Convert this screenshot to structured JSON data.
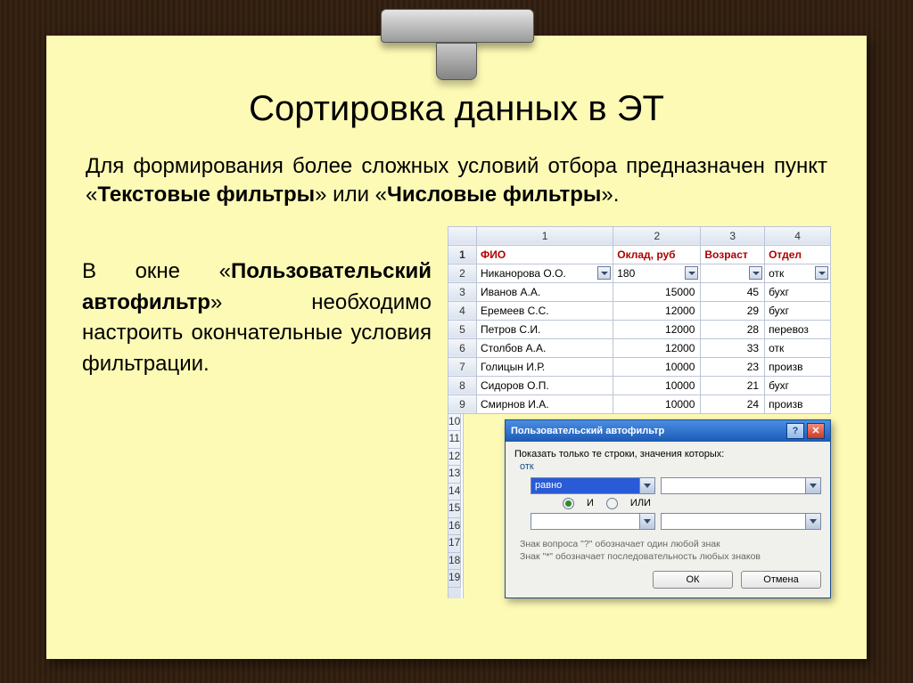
{
  "title": "Сортировка данных в ЭТ",
  "para1_parts": {
    "p1": "Для формирования более сложных условий отбора предназначен пункт «",
    "b1": "Текстовые фильтры",
    "p2": "» или «",
    "b2": "Числовые фильтры",
    "p3": "»."
  },
  "para2_parts": {
    "p1": "В окне «",
    "b1": "Пользовательский автофильтр",
    "p2": "» необходимо настроить окончательные условия фильтрации."
  },
  "sheet": {
    "colnums": [
      "1",
      "2",
      "3",
      "4"
    ],
    "headers": [
      "ФИО",
      "Оклад, руб",
      "Возраст",
      "Отдел"
    ],
    "filter_vals": [
      "Никанорова О.О.",
      "180",
      "",
      "отк"
    ],
    "rows": [
      {
        "n": "3",
        "c": [
          "Иванов А.А.",
          "15000",
          "45",
          "бухг"
        ]
      },
      {
        "n": "4",
        "c": [
          "Еремеев С.С.",
          "12000",
          "29",
          "бухг"
        ]
      },
      {
        "n": "5",
        "c": [
          "Петров С.И.",
          "12000",
          "28",
          "перевоз"
        ]
      },
      {
        "n": "6",
        "c": [
          "Столбов А.А.",
          "12000",
          "33",
          "отк"
        ]
      },
      {
        "n": "7",
        "c": [
          "Голицын И.Р.",
          "10000",
          "23",
          "произв"
        ]
      },
      {
        "n": "8",
        "c": [
          "Сидоров О.П.",
          "10000",
          "21",
          "бухг"
        ]
      },
      {
        "n": "9",
        "c": [
          "Смирнов И.А.",
          "10000",
          "24",
          "произв"
        ]
      }
    ],
    "extra_rownums": [
      "10",
      "11",
      "12",
      "13",
      "14",
      "15",
      "16",
      "17",
      "18",
      "19"
    ]
  },
  "dialog": {
    "title": "Пользовательский автофильтр",
    "prompt": "Показать только те строки, значения которых:",
    "field": "отк",
    "op1": "равно",
    "radio_and": "И",
    "radio_or": "ИЛИ",
    "hint1": "Знак вопроса \"?\" обозначает один любой знак",
    "hint2": "Знак \"*\" обозначает последовательность любых знаков",
    "ok": "ОК",
    "cancel": "Отмена"
  }
}
